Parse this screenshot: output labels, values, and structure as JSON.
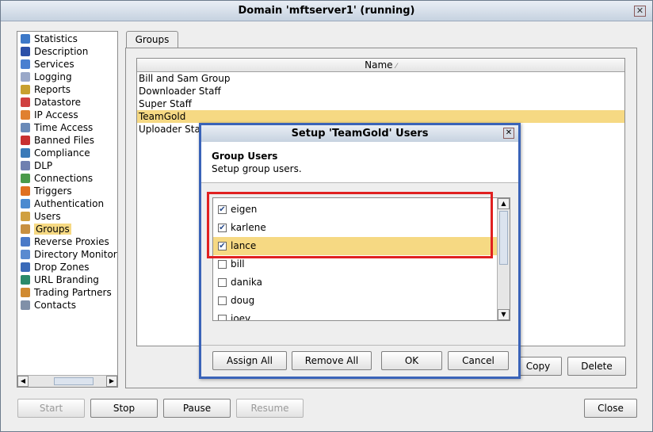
{
  "window": {
    "title": "Domain 'mftserver1' (running)",
    "close_glyph": "✕"
  },
  "nav": {
    "items": [
      {
        "label": "Statistics",
        "icon": "statistics-icon",
        "color": "#3c78c8"
      },
      {
        "label": "Description",
        "icon": "description-icon",
        "color": "#2a4fa8"
      },
      {
        "label": "Services",
        "icon": "services-icon",
        "color": "#4a7fd0"
      },
      {
        "label": "Logging",
        "icon": "logging-icon",
        "color": "#9aa8c8"
      },
      {
        "label": "Reports",
        "icon": "reports-icon",
        "color": "#c8a030"
      },
      {
        "label": "Datastore",
        "icon": "datastore-icon",
        "color": "#d04040"
      },
      {
        "label": "IP Access",
        "icon": "ip-access-icon",
        "color": "#e08030"
      },
      {
        "label": "Time Access",
        "icon": "time-access-icon",
        "color": "#6a8ab8"
      },
      {
        "label": "Banned Files",
        "icon": "banned-files-icon",
        "color": "#c83030"
      },
      {
        "label": "Compliance",
        "icon": "compliance-icon",
        "color": "#3a7ab8"
      },
      {
        "label": "DLP",
        "icon": "dlp-icon",
        "color": "#7080b0"
      },
      {
        "label": "Connections",
        "icon": "connections-icon",
        "color": "#4a9a4a"
      },
      {
        "label": "Triggers",
        "icon": "triggers-icon",
        "color": "#e07020"
      },
      {
        "label": "Authentication",
        "icon": "authentication-icon",
        "color": "#4a8ad0"
      },
      {
        "label": "Users",
        "icon": "users-icon",
        "color": "#d0a040"
      },
      {
        "label": "Groups",
        "icon": "groups-icon",
        "color": "#c89040"
      },
      {
        "label": "Reverse Proxies",
        "icon": "reverse-proxies-icon",
        "color": "#4a7ac8"
      },
      {
        "label": "Directory Monitor",
        "icon": "directory-monitor-icon",
        "color": "#5a8ad0"
      },
      {
        "label": "Drop Zones",
        "icon": "drop-zones-icon",
        "color": "#3a6ab8"
      },
      {
        "label": "URL Branding",
        "icon": "url-branding-icon",
        "color": "#2a8a6a"
      },
      {
        "label": "Trading Partners",
        "icon": "trading-partners-icon",
        "color": "#d08a30"
      },
      {
        "label": "Contacts",
        "icon": "contacts-icon",
        "color": "#8090a8"
      }
    ],
    "selected": "Groups"
  },
  "tab": {
    "label": "Groups"
  },
  "table": {
    "header": "Name",
    "sort_glyph": "⁄",
    "rows": [
      "Bill and Sam Group",
      "Downloader Staff",
      "Super Staff",
      "TeamGold",
      "Uploader Staff"
    ],
    "selected": "TeamGold"
  },
  "panel_buttons": {
    "copy": "Copy",
    "delete": "Delete"
  },
  "bottom_buttons": {
    "start": "Start",
    "stop": "Stop",
    "pause": "Pause",
    "resume": "Resume",
    "close": "Close"
  },
  "dialog": {
    "title": "Setup 'TeamGold' Users",
    "close_glyph": "✕",
    "header_title": "Group Users",
    "header_subtitle": "Setup group users.",
    "users": [
      {
        "name": "eigen",
        "checked": true
      },
      {
        "name": "karlene",
        "checked": true
      },
      {
        "name": "lance",
        "checked": true,
        "selected": true
      },
      {
        "name": "bill",
        "checked": false
      },
      {
        "name": "danika",
        "checked": false
      },
      {
        "name": "doug",
        "checked": false
      },
      {
        "name": "joey",
        "checked": false
      }
    ],
    "buttons": {
      "assign_all": "Assign All",
      "remove_all": "Remove All",
      "ok": "OK",
      "cancel": "Cancel"
    },
    "check_glyph": "✔"
  }
}
